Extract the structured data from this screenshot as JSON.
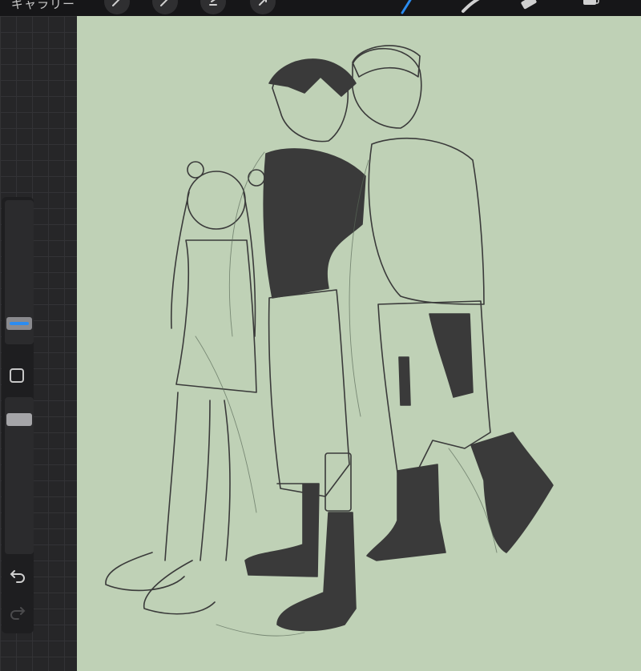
{
  "toolbar": {
    "gallery_label": "ギャラリー",
    "left_tools": [
      {
        "name": "actions-wrench-icon"
      },
      {
        "name": "adjustments-wand-icon"
      },
      {
        "name": "selection-icon"
      },
      {
        "name": "transform-arrow-icon"
      }
    ],
    "right_tools": [
      {
        "name": "brush-icon",
        "active": true
      },
      {
        "name": "smudge-icon"
      },
      {
        "name": "eraser-icon"
      },
      {
        "name": "layers-icon"
      }
    ],
    "active_color": "#2b8cf0"
  },
  "sidebar": {
    "brush_size_icon": "brush-size-slider",
    "modify_icon": "modify-square-icon",
    "opacity_icon": "opacity-slider",
    "undo_icon": "undo-arrow-icon",
    "redo_icon": "redo-arrow-icon",
    "brush_size_level": 0.3,
    "opacity_level": 0.95
  },
  "canvas": {
    "background_color": "#bfd1b6",
    "line_color": "#3a3a3a",
    "artwork": "line-art-sketch-three-characters"
  }
}
